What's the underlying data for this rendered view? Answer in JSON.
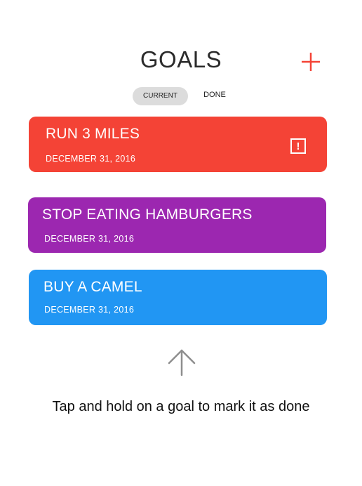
{
  "header": {
    "title": "GOALS",
    "add_icon": "plus-icon",
    "add_color": "#f44336"
  },
  "tabs": [
    {
      "label": "CURRENT",
      "selected": true
    },
    {
      "label": "DONE",
      "selected": false
    }
  ],
  "colors": {
    "tab_selected_bg": "#dcdcdc",
    "red": "#f44336",
    "purple": "#9c27b0",
    "blue": "#2196f3",
    "arrow": "#8e8e8e"
  },
  "goals": [
    {
      "title": "RUN 3 MILES",
      "date": "DECEMBER 31, 2016",
      "color": "#f44336",
      "alert": true,
      "alert_icon": "exclamation-box-icon",
      "alert_text": "!"
    },
    {
      "title": "STOP EATING HAMBURGERS",
      "date": "DECEMBER 31, 2016",
      "color": "#9c27b0",
      "alert": false
    },
    {
      "title": "BUY A CAMEL",
      "date": "DECEMBER 31, 2016",
      "color": "#2196f3",
      "alert": false
    }
  ],
  "hint": {
    "icon": "arrow-up-icon",
    "text": "Tap and hold on a goal to mark it as done"
  }
}
